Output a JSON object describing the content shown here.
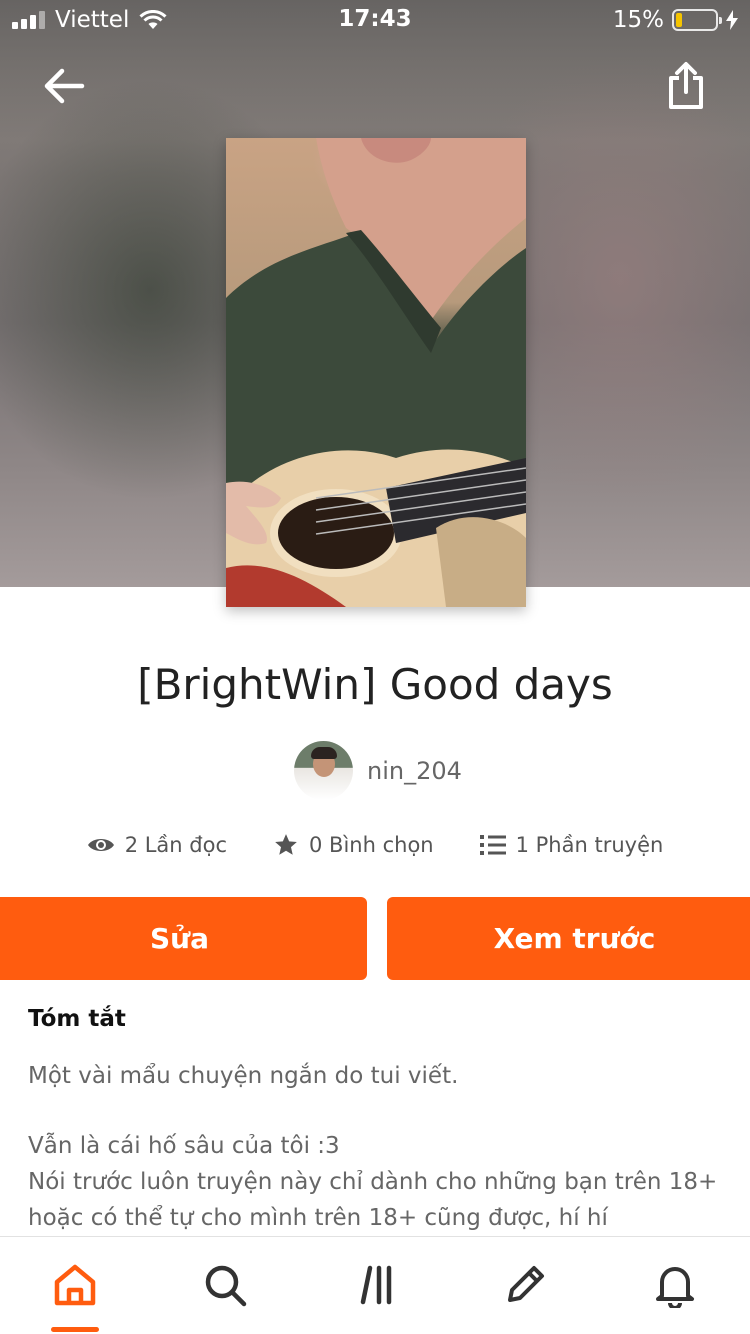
{
  "status_bar": {
    "carrier": "Viettel",
    "time": "17:43",
    "battery_percent_label": "15%",
    "battery_level": 0.15
  },
  "header": {
    "back_icon": "arrow-left-icon",
    "share_icon": "share-icon"
  },
  "story": {
    "title": "[BrightWin] Good days",
    "author": "nin_204",
    "stats": {
      "reads": "2 Lần đọc",
      "votes": "0 Bình chọn",
      "parts": "1 Phần truyện"
    }
  },
  "actions": {
    "edit_label": "Sửa",
    "preview_label": "Xem trước"
  },
  "summary": {
    "heading": "Tóm tắt",
    "line1": "Một vài mẩu chuyện ngắn do tui viết.",
    "line2": "Vẫn là cái hố sâu của tôi :3",
    "line3": "Nói trước luôn truyện này chỉ dành cho những bạn trên 18+",
    "line4": "hoặc có thể tự cho mình trên 18+ cũng được, hí hí"
  },
  "tabbar": {
    "items": [
      "home-icon",
      "search-icon",
      "library-icon",
      "write-icon",
      "notifications-icon"
    ],
    "active": "home-icon"
  },
  "colors": {
    "accent": "#ff5c0f",
    "battery": "#f5c400"
  }
}
